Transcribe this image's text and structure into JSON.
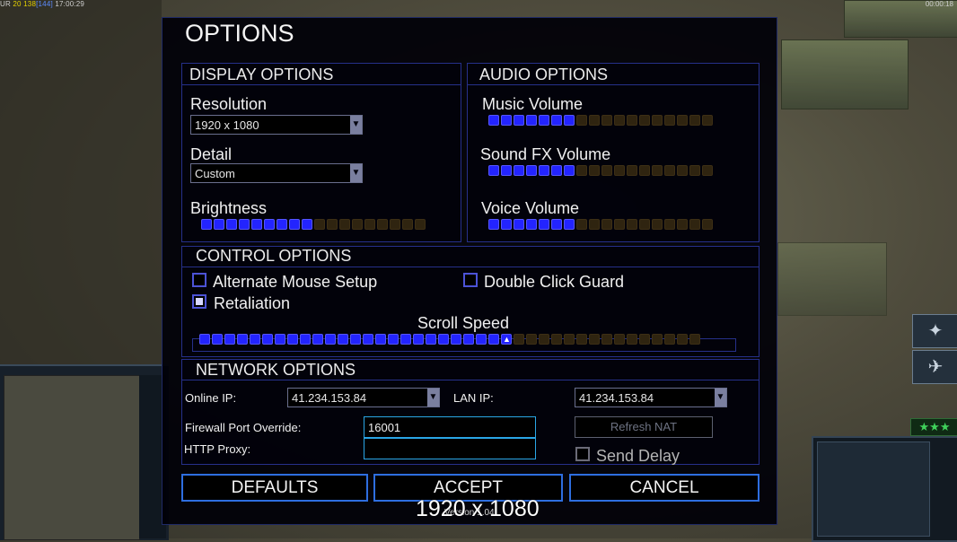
{
  "hud": {
    "left_prefix": "UR",
    "left_a": "20",
    "left_b": "138",
    "left_c": "[144]",
    "left_time": "17:00:29",
    "right_time": "00:00:18"
  },
  "dialog": {
    "title": "OPTIONS",
    "display": {
      "section_title": "DISPLAY OPTIONS",
      "resolution_label": "Resolution",
      "resolution_value": "1920 x 1080",
      "detail_label": "Detail",
      "detail_value": "Custom",
      "brightness_label": "Brightness",
      "brightness_level": 9,
      "brightness_total": 18
    },
    "audio": {
      "section_title": "AUDIO OPTIONS",
      "music_label": "Music Volume",
      "music_level": 7,
      "sfx_label": "Sound FX Volume",
      "sfx_level": 7,
      "voice_label": "Voice Volume",
      "voice_level": 7,
      "total_segments": 18
    },
    "control": {
      "section_title": "CONTROL OPTIONS",
      "alt_mouse_label": "Alternate Mouse Setup",
      "alt_mouse_checked": false,
      "double_click_label": "Double Click Guard",
      "double_click_checked": false,
      "retaliation_label": "Retaliation",
      "retaliation_checked": true,
      "scroll_speed_label": "Scroll Speed",
      "scroll_speed_level": 25,
      "scroll_speed_total": 40
    },
    "network": {
      "section_title": "NETWORK OPTIONS",
      "online_ip_label": "Online IP:",
      "online_ip_value": "41.234.153.84",
      "lan_ip_label": "LAN IP:",
      "lan_ip_value": "41.234.153.84",
      "firewall_label": "Firewall Port Override:",
      "firewall_value": "16001",
      "proxy_label": "HTTP Proxy:",
      "proxy_value": "",
      "refresh_nat_label": "Refresh NAT",
      "send_delay_label": "Send Delay",
      "send_delay_checked": false
    },
    "buttons": {
      "defaults": "DEFAULTS",
      "accept": "ACCEPT",
      "cancel": "CANCEL"
    },
    "version_text": "Version 1.04"
  },
  "overlay_resolution": "1920 x 1080",
  "side_panel": {
    "rank_stars": "★★★",
    "satellite_icon": "satellite-icon",
    "unit_icon": "helicopter-icon"
  },
  "colors": {
    "slider_on": "#2324ff",
    "slider_off": "#2f2410",
    "panel_border": "#26308a",
    "field_border": "#2aa6e6"
  }
}
